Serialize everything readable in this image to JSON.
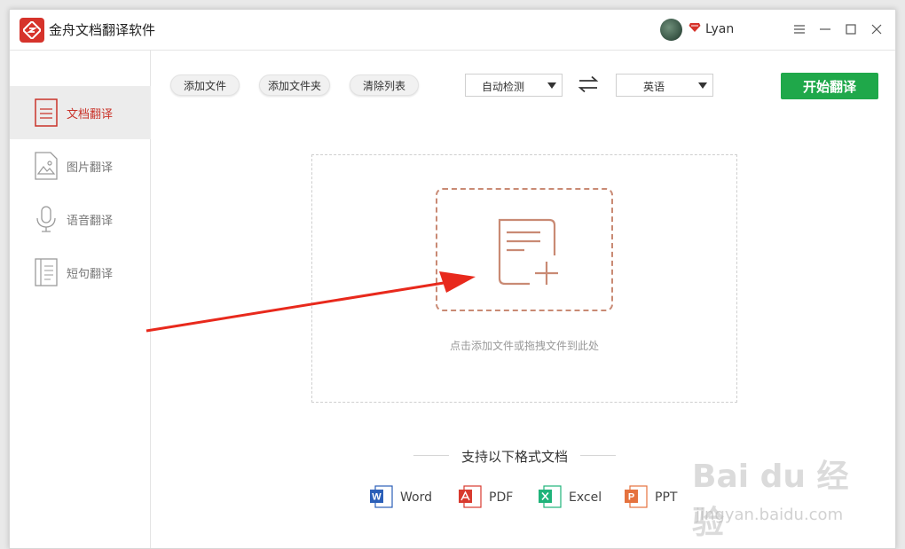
{
  "app": {
    "title": "金舟文档翻译软件",
    "brand_color": "#d6332b"
  },
  "user": {
    "name": "Lyan"
  },
  "sidebar": {
    "items": [
      {
        "label": "文档翻译",
        "icon": "document-icon",
        "active": true
      },
      {
        "label": "图片翻译",
        "icon": "image-icon",
        "active": false
      },
      {
        "label": "语音翻译",
        "icon": "microphone-icon",
        "active": false
      },
      {
        "label": "短句翻译",
        "icon": "sentence-icon",
        "active": false
      }
    ]
  },
  "toolbar": {
    "add_file": "添加文件",
    "add_folder": "添加文件夹",
    "clear_list": "清除列表",
    "source_lang": "自动检测",
    "target_lang": "英语",
    "start": "开始翻译",
    "start_color": "#1fa84a"
  },
  "dropzone": {
    "hint": "点击添加文件或拖拽文件到此处",
    "accent": "#c98a74"
  },
  "formats": {
    "title": "支持以下格式文档",
    "items": [
      {
        "name": "Word",
        "color": "#2b5fb8"
      },
      {
        "name": "PDF",
        "color": "#d83a2e"
      },
      {
        "name": "Excel",
        "color": "#1fb37a"
      },
      {
        "name": "PPT",
        "color": "#e5723e"
      }
    ]
  },
  "watermark": {
    "main": "Bai du 经验",
    "sub": "jingyan.baidu.com"
  }
}
